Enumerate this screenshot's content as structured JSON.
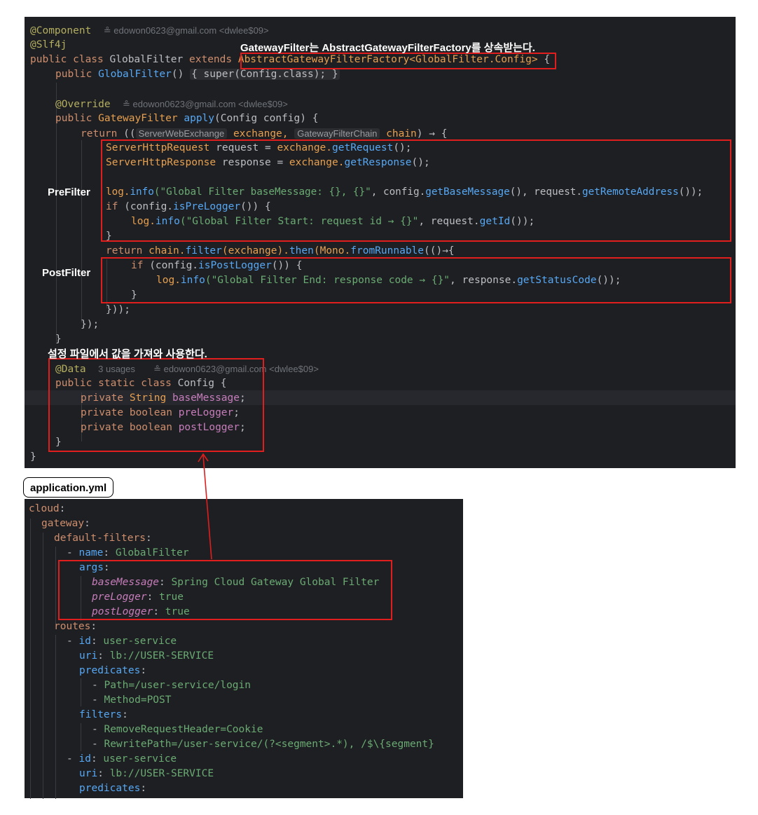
{
  "code": {
    "component_ann": "@Component",
    "author1": "≗ edowon0623@gmail.com <dwlee$09>",
    "slf4j": "@Slf4j",
    "l3_kw": "public class",
    "l3_cls": "GlobalFilter",
    "l3_extends": "extends",
    "l3_parent": "AbstractGatewayFilterFactory<GlobalFilter.Config>",
    "l3_brace": "{",
    "l4_kw": "public",
    "l4_fn": "GlobalFilter",
    "l4_rest": "()",
    "l4_body": "{ super(Config.class); }",
    "override": "@Override",
    "author2": "≗ edowon0623@gmail.com <dwlee$09>",
    "l7_kw": "public",
    "l7_type": "GatewayFilter",
    "l7_fn": "apply",
    "l7_rest": "(Config config) {",
    "l8_kw": "return",
    "l8_open": "((",
    "l8_hint1": "ServerWebExchange",
    "l8_p1": "exchange,",
    "l8_hint2": "GatewayFilterChain",
    "l8_p2": "chain",
    "l8_arrow": ") → {",
    "l9_type": "ServerHttpRequest",
    "l9_var": " request = ",
    "l9_obj": "exchange.",
    "l9_fn": "getRequest",
    "l9_end": "();",
    "l10_type": "ServerHttpResponse",
    "l10_var": " response = ",
    "l10_obj": "exchange.",
    "l10_fn": "getResponse",
    "l10_end": "();",
    "l12_log": "log.",
    "l12_fn": "info",
    "l12_str": "(\"Global Filter baseMessage: {}, {}\"",
    "l12_rest1": ", config.",
    "l12_fn2": "getBaseMessage",
    "l12_rest2": "(), request.",
    "l12_fn3": "getRemoteAddress",
    "l12_end": "());",
    "l13_kw": "if",
    "l13_rest": " (config.",
    "l13_fn": "isPreLogger",
    "l13_end": "()) {",
    "l14_log": "log.",
    "l14_fn": "info",
    "l14_str": "(\"Global Filter Start: request id → {}\"",
    "l14_rest": ", request.",
    "l14_fn2": "getId",
    "l14_end": "());",
    "l15": "}",
    "l16_kw": "return",
    "l16_obj": "chain.",
    "l16_fn": "filter",
    "l16_mid": "(exchange).",
    "l16_fn2": "then",
    "l16_mid2": "(Mono.",
    "l16_fn3": "fromRunnable",
    "l16_end": "(()→{",
    "l17_kw": "if",
    "l17_rest": " (config.",
    "l17_fn": "isPostLogger",
    "l17_end": "()) {",
    "l18_log": "log.",
    "l18_fn": "info",
    "l18_str": "(\"Global Filter End: response code → {}\"",
    "l18_rest": ", response.",
    "l18_fn2": "getStatusCode",
    "l18_end": "());",
    "l19": "}",
    "l20": "}));",
    "l21": "});",
    "l22": "}",
    "data_ann": "@Data",
    "usages": "3 usages",
    "author3": "≗ edowon0623@gmail.com <dwlee$09>",
    "l24_kw": "public static class",
    "l24_cls": "Config",
    "l24_brace": "{",
    "l25_kw": "private",
    "l25_type": "String",
    "l25_fld": "baseMessage",
    "l26_kw": "private",
    "l26_type": "boolean",
    "l26_fld": "preLogger",
    "l27_kw": "private",
    "l27_type": "boolean",
    "l27_fld": "postLogger",
    "l28": "}",
    "l29": "}"
  },
  "annotations": {
    "gateway_note": "GatewayFilter는 AbstractGatewayFilterFactory를 상속받는다.",
    "pre_filter": "PreFilter",
    "post_filter": "PostFilter",
    "config_note": "설정 파일에서 값을 가져와 사용한다.",
    "file_name": "application.yml"
  },
  "yaml": {
    "cloud": "cloud",
    "gateway": "gateway",
    "default_filters": "default-filters",
    "name_key": "name",
    "name_val": "GlobalFilter",
    "args": "args",
    "baseMessage_key": "baseMessage",
    "baseMessage_val": "Spring Cloud Gateway Global Filter",
    "preLogger_key": "preLogger",
    "preLogger_val": "true",
    "postLogger_key": "postLogger",
    "postLogger_val": "true",
    "routes": "routes",
    "id_key": "id",
    "id_val": "user-service",
    "uri_key": "uri",
    "uri_val": "lb://USER-SERVICE",
    "predicates": "predicates",
    "pred1": "Path=/user-service/login",
    "pred2": "Method=POST",
    "filters": "filters",
    "filter1": "RemoveRequestHeader=Cookie",
    "filter2": "RewritePath=/user-service/(?<segment>.*), /$\\{segment}",
    "id2_val": "user-service",
    "uri2_val": "lb://USER-SERVICE",
    "predicates2": "predicates"
  },
  "colors": {
    "editor_bg": "#1e1f22",
    "highlight_box": "#e01e1e",
    "keyword": "#cf8e6d",
    "function": "#56a8f5",
    "string": "#6aab73",
    "field": "#c77dbb",
    "annotation": "#b3ae60"
  }
}
